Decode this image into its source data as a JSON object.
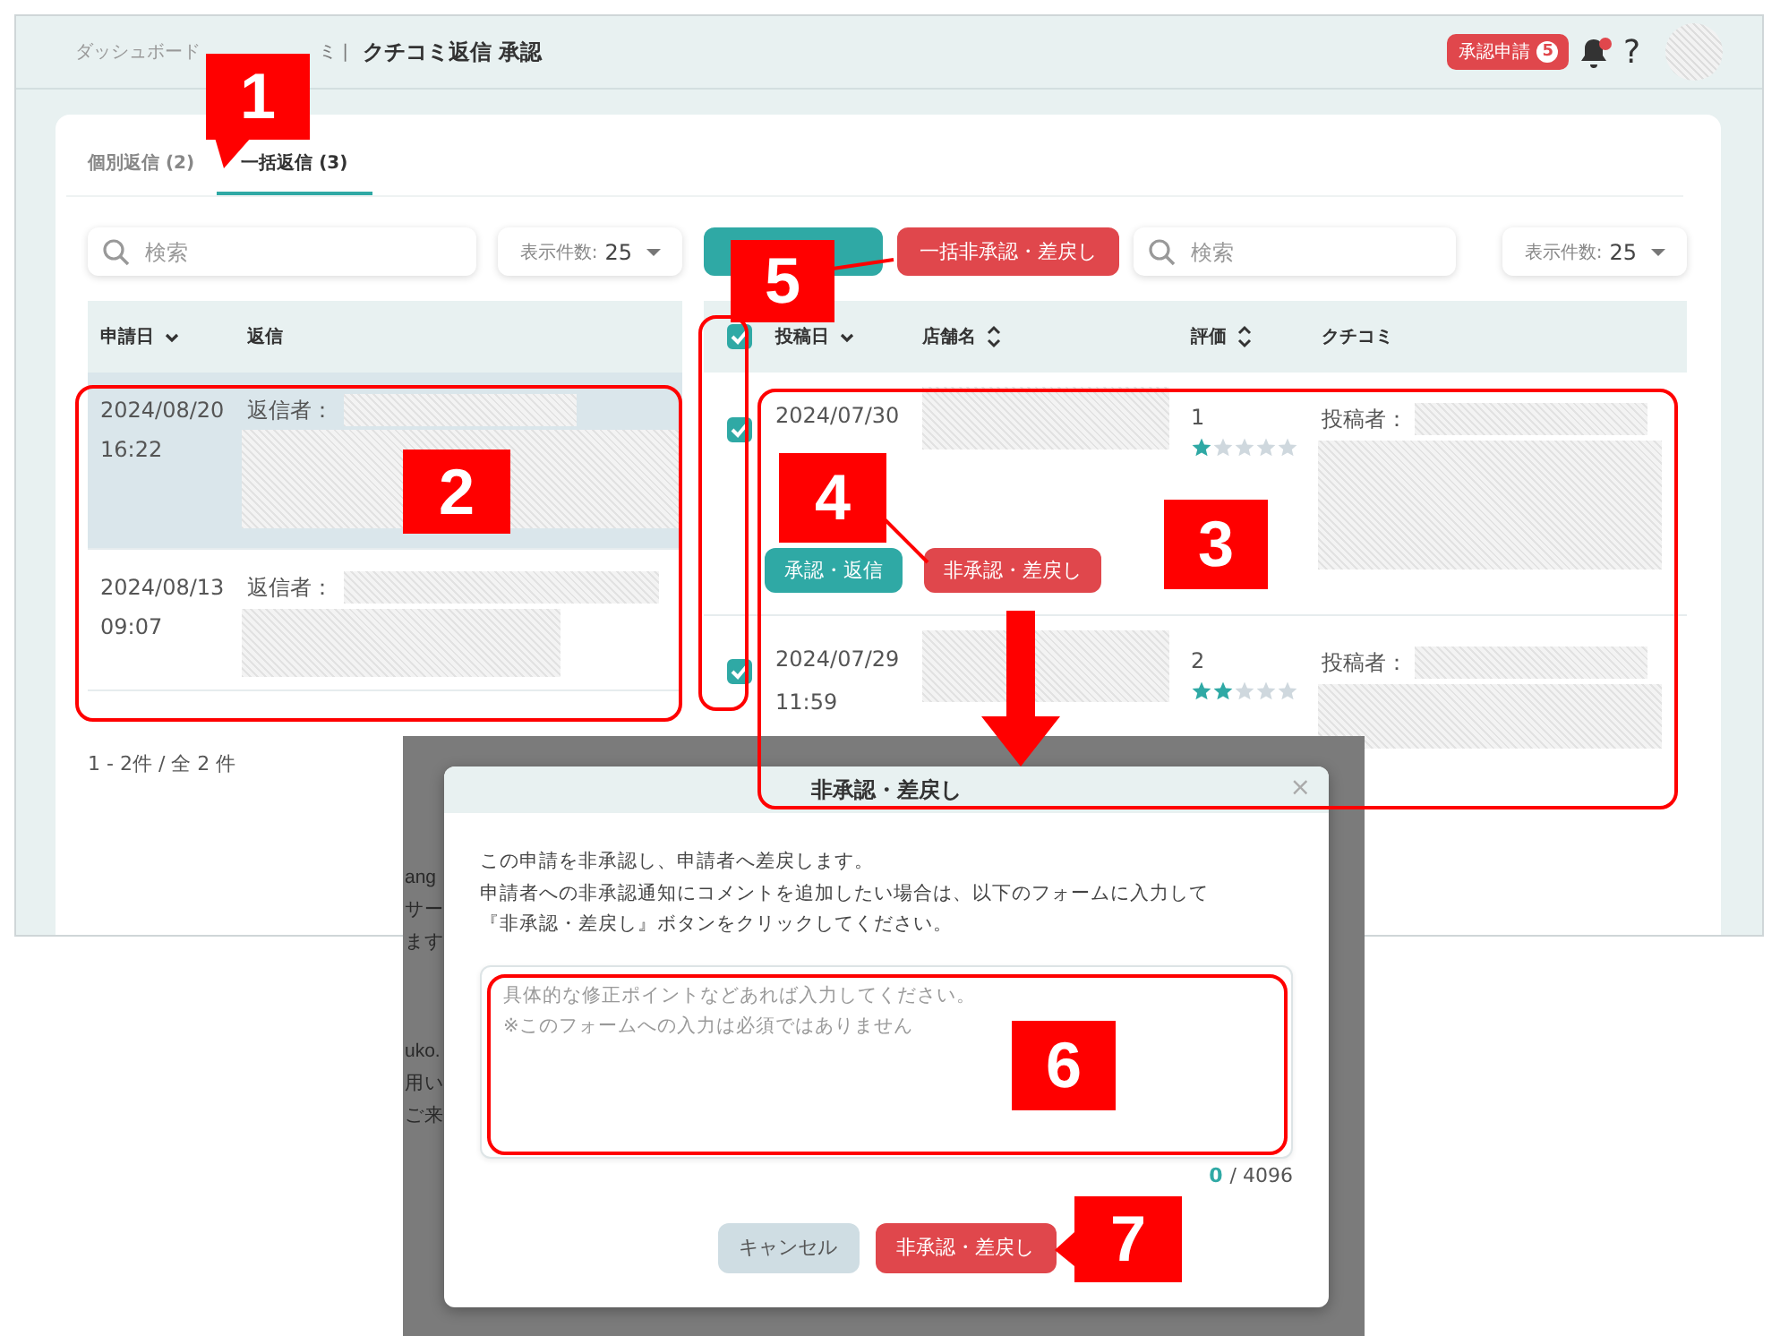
{
  "header": {
    "breadcrumb": [
      "ダッシュボード",
      "ミ |"
    ],
    "title": "クチコミ返信 承認",
    "approval_badge": {
      "label": "承認申請",
      "count": "5"
    },
    "notifications": {
      "unread": true
    },
    "help": "?"
  },
  "tabs": [
    {
      "label": "個別返信 (2)",
      "selected": false
    },
    {
      "label": "一括返信 (3)",
      "selected": true
    }
  ],
  "left_panel": {
    "search": {
      "placeholder": "検索"
    },
    "per_page": {
      "label": "表示件数:",
      "value": "25"
    },
    "columns": [
      {
        "label": "申請日",
        "sorted": true
      },
      {
        "label": "返信",
        "sorted": false,
        "sortable": false
      }
    ],
    "rows": [
      {
        "date": "2024/08/20",
        "time": "16:22",
        "replier_label": "返信者：",
        "selected": true
      },
      {
        "date": "2024/08/13",
        "time": "09:07",
        "replier_label": "返信者：",
        "selected": false
      }
    ],
    "pagination": "1 - 2件 / 全 2 件"
  },
  "right_panel": {
    "bulk_buttons": [
      {
        "kind": "approve"
      },
      {
        "kind": "reject",
        "label": "一括非承認・差戻し"
      }
    ],
    "search": {
      "placeholder": "検索"
    },
    "per_page": {
      "label": "表示件数:",
      "value": "25"
    },
    "select_all": {
      "checked": true
    },
    "columns": [
      {
        "label": "投稿日",
        "sorted": true
      },
      {
        "label": "店舗名",
        "sorted": false,
        "sortable": true
      },
      {
        "label": "評価",
        "sorted": false,
        "sortable": true
      },
      {
        "label": "クチコミ",
        "sorted": false,
        "sortable": false
      }
    ],
    "rows": [
      {
        "checked": true,
        "date": "2024/07/30",
        "rating": "1",
        "stars": 1,
        "poster_label": "投稿者：",
        "actions": [
          {
            "kind": "approve",
            "label": "承認・返信"
          },
          {
            "kind": "reject",
            "label": "非承認・差戻し"
          }
        ]
      },
      {
        "checked": true,
        "date": "2024/07/29",
        "time": "11:59",
        "rating": "2",
        "stars": 2,
        "poster_label": "投稿者："
      }
    ]
  },
  "modal": {
    "title": "非承認・差戻し",
    "close": "×",
    "message": [
      "この申請を非承認し、申請者へ差戻します。",
      "申請者への非承認通知にコメントを追加したい場合は、以下のフォームに入力して",
      "『非承認・差戻し』ボタンをクリックしてください。"
    ],
    "comment": {
      "placeholder": "具体的な修正ポイントなどあれば入力してください。\n※このフォームへの入力は必須ではありません"
    },
    "counter": {
      "current": "0",
      "max": "/ 4096"
    },
    "buttons": [
      {
        "kind": "cancel",
        "label": "キャンセル"
      },
      {
        "kind": "reject",
        "label": "非承認・差戻し"
      }
    ],
    "backdrop_texts": [
      "ang",
      "サー",
      "ます",
      "uko.",
      "用い",
      "ご来"
    ]
  },
  "annotations": {
    "callouts": [
      "1",
      "2",
      "3",
      "4",
      "5",
      "6",
      "7"
    ]
  }
}
